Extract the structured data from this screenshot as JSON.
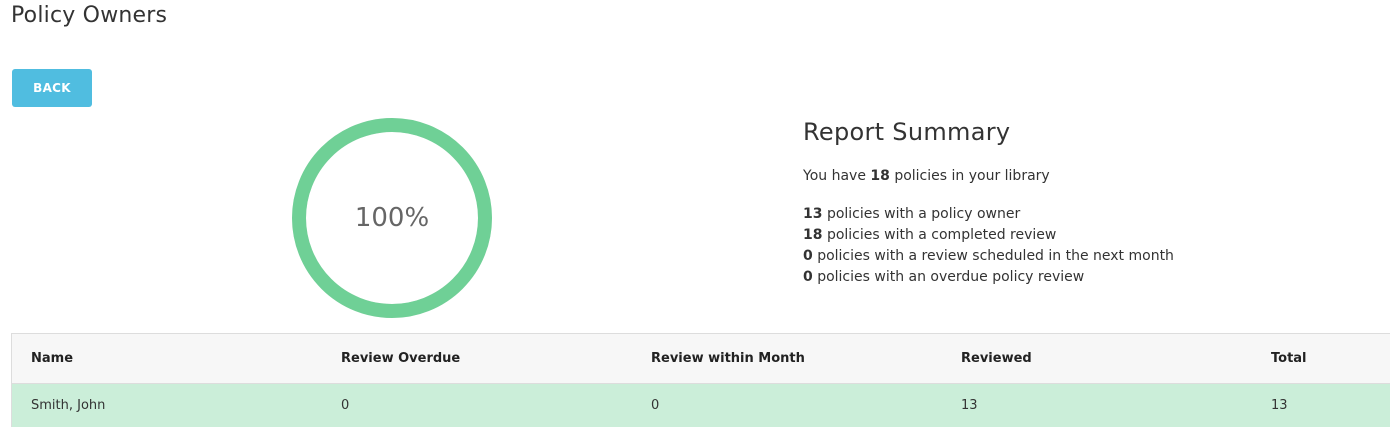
{
  "page": {
    "title": "Policy Owners"
  },
  "toolbar": {
    "back_label": "BACK"
  },
  "gauge": {
    "label": "100%",
    "percent": 100,
    "color": "#6fd096"
  },
  "summary": {
    "title": "Report Summary",
    "intro_prefix": "You have",
    "intro_count": "18",
    "intro_suffix": "policies in your library",
    "stats": [
      {
        "count": "13",
        "text": "policies with a policy owner"
      },
      {
        "count": "18",
        "text": "policies with a completed review"
      },
      {
        "count": "0",
        "text": "policies with a review scheduled in the next month"
      },
      {
        "count": "0",
        "text": "policies with an overdue policy review"
      }
    ]
  },
  "table": {
    "columns": [
      "Name",
      "Review Overdue",
      "Review within Month",
      "Reviewed",
      "Total"
    ],
    "rows": [
      [
        "Smith, John",
        "0",
        "0",
        "13",
        "13"
      ]
    ]
  },
  "colors": {
    "button": "#50bde0",
    "row_highlight": "#cbeed9",
    "header_bg": "#f7f7f7"
  }
}
